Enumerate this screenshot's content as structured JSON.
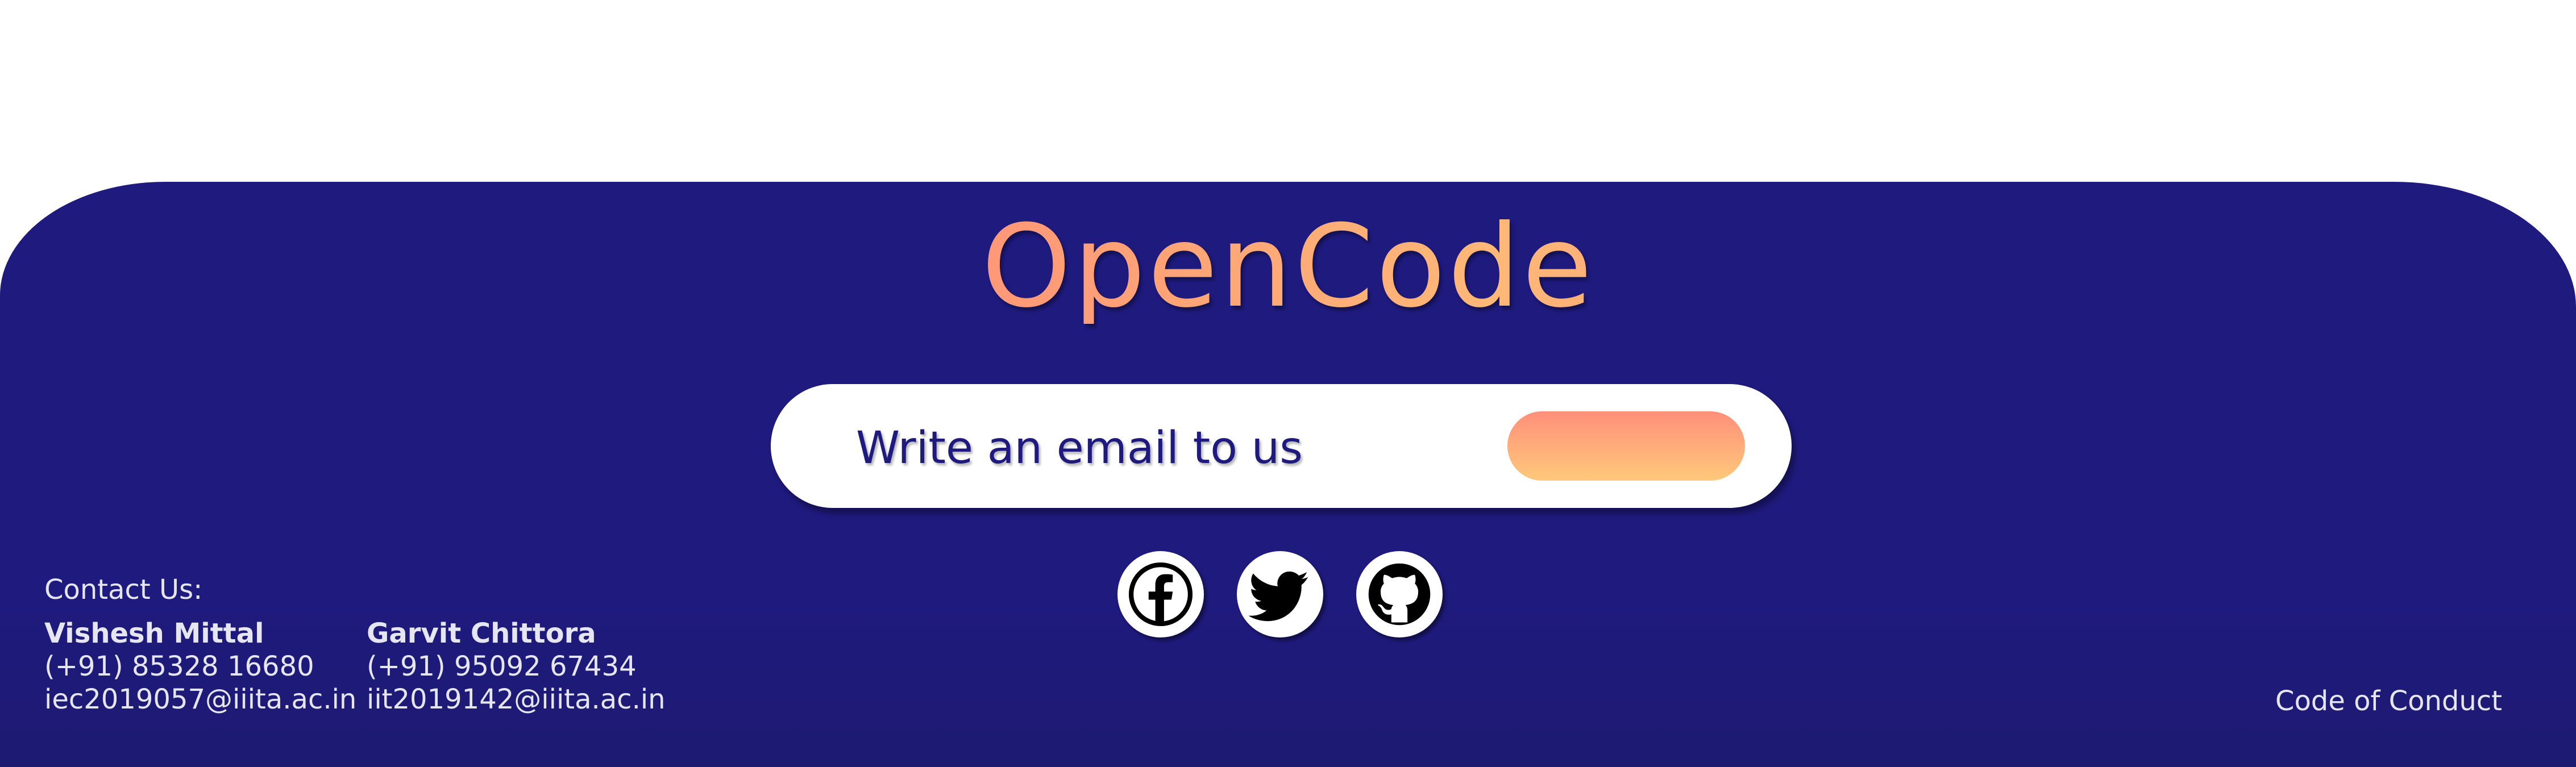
{
  "brand": {
    "name": "OpenCode",
    "gradient_colors": [
      "#ff5a78",
      "#ffb877",
      "#ff6d76"
    ]
  },
  "email_bar": {
    "placeholder": "Write an email to us",
    "button_colors": [
      "#ff8f7a",
      "#ffc97a"
    ]
  },
  "socials": [
    {
      "name": "facebook",
      "icon": "facebook-icon"
    },
    {
      "name": "twitter",
      "icon": "twitter-icon"
    },
    {
      "name": "github",
      "icon": "github-icon"
    }
  ],
  "contact": {
    "heading": "Contact Us:",
    "people": [
      {
        "name": "Vishesh Mittal",
        "phone": "(+91) 85328 16680",
        "email": "iec2019057@iiita.ac.in"
      },
      {
        "name": "Garvit Chittora",
        "phone": "(+91) 95092 67434",
        "email": "iit2019142@iiita.ac.in"
      }
    ]
  },
  "links": {
    "code_of_conduct": "Code of Conduct"
  },
  "colors": {
    "footer_bg": "#1f1a7e",
    "text_light": "#e6e6f2",
    "page_bg": "#ffffff"
  }
}
